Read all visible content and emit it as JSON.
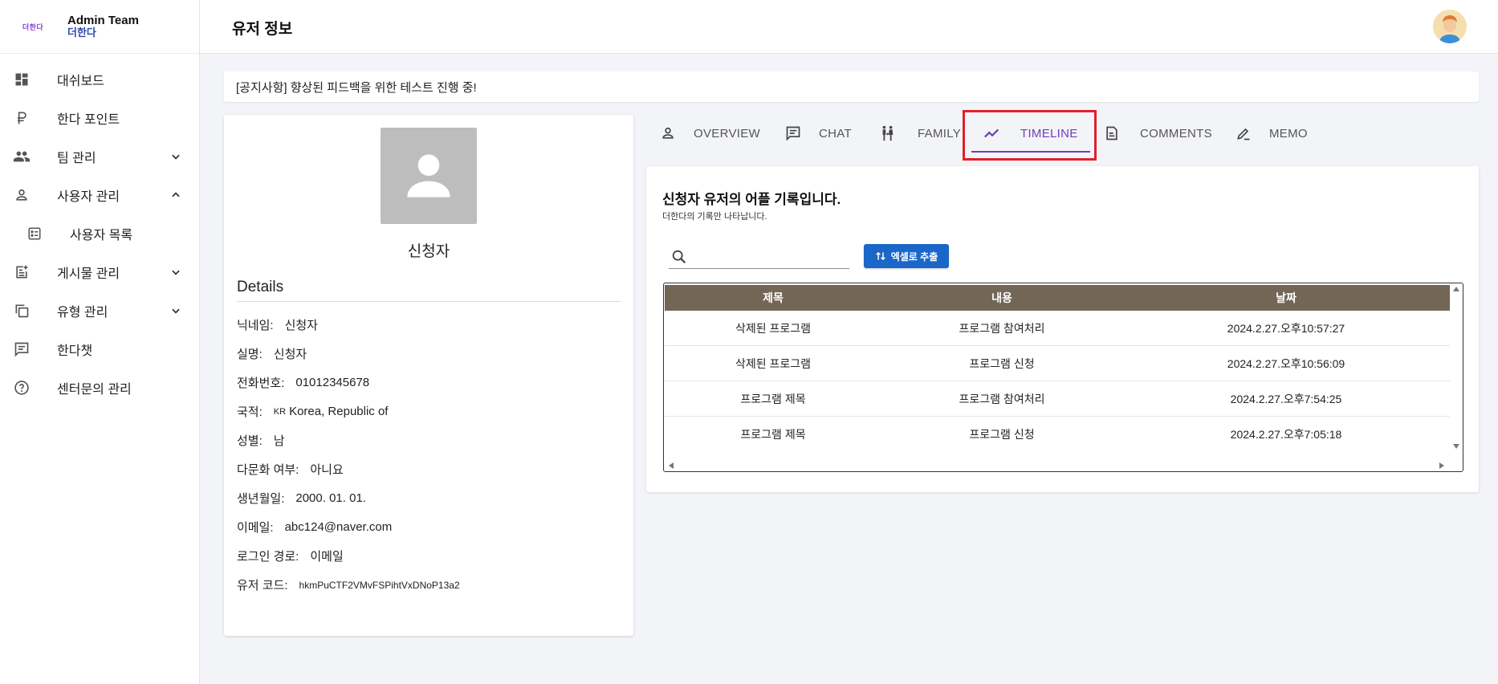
{
  "brand": {
    "logo_text": "더한다",
    "title": "Admin Team",
    "subtitle": "더한다"
  },
  "sidebar": {
    "items": [
      {
        "label": "대쉬보드",
        "icon": "dashboard-icon"
      },
      {
        "label": "한다 포인트",
        "icon": "ruble-icon"
      },
      {
        "label": "팀 관리",
        "icon": "group-icon",
        "expandable": true
      },
      {
        "label": "사용자 관리",
        "icon": "person-icon",
        "expanded": true
      },
      {
        "label": "사용자 목록",
        "icon": "list-icon",
        "sub": true
      },
      {
        "label": "게시물 관리",
        "icon": "post-add-icon",
        "expandable": true
      },
      {
        "label": "유형 관리",
        "icon": "copy-icon",
        "expandable": true
      },
      {
        "label": "한다챗",
        "icon": "chat-icon"
      },
      {
        "label": "센터문의 관리",
        "icon": "help-icon"
      }
    ]
  },
  "header": {
    "title": "유저 정보"
  },
  "notice": {
    "text": "[공지사항] 향상된 피드백을 위한 테스트 진행 중!"
  },
  "profile": {
    "name": "신청자",
    "details_title": "Details",
    "fields": [
      {
        "label": "닉네임:",
        "value": "신청자"
      },
      {
        "label": "실명:",
        "value": "신청자"
      },
      {
        "label": "전화번호:",
        "value": "01012345678"
      },
      {
        "label": "국적:",
        "flag": "KR",
        "value": "Korea, Republic of"
      },
      {
        "label": "성별:",
        "value": "남"
      },
      {
        "label": "다문화 여부:",
        "value": "아니요"
      },
      {
        "label": "생년월일:",
        "value": "2000. 01. 01."
      },
      {
        "label": "이메일:",
        "value": "abc124@naver.com"
      },
      {
        "label": "로그인 경로:",
        "value": "이메일"
      },
      {
        "label": "유저 코드:",
        "value": "hkmPuCTF2VMvFSPihtVxDNoP13a2"
      }
    ]
  },
  "tabs": [
    {
      "label": "OVERVIEW",
      "icon": "person-icon"
    },
    {
      "label": "CHAT",
      "icon": "chat-icon"
    },
    {
      "label": "FAMILY",
      "icon": "family-icon"
    },
    {
      "label": "TIMELINE",
      "icon": "timeline-icon",
      "active": true
    },
    {
      "label": "COMMENTS",
      "icon": "document-icon"
    },
    {
      "label": "MEMO",
      "icon": "edit-icon"
    }
  ],
  "timeline": {
    "title": "신청자 유저의 어플 기록입니다.",
    "subtitle": "더한다의 기록만 나타납니다.",
    "search_placeholder": "",
    "export_label": "엑셀로 추출",
    "columns": [
      "제목",
      "내용",
      "날짜"
    ],
    "rows": [
      [
        "삭제된 프로그램",
        "프로그램 참여처리",
        "2024.2.27.오후10:57:27"
      ],
      [
        "삭제된 프로그램",
        "프로그램 신청",
        "2024.2.27.오후10:56:09"
      ],
      [
        "프로그램 제목",
        "프로그램 참여처리",
        "2024.2.27.오후7:54:25"
      ],
      [
        "프로그램 제목",
        "프로그램 신청",
        "2024.2.27.오후7:05:18"
      ]
    ]
  },
  "colors": {
    "accent": "#6c3fb5",
    "highlight": "#e0202a",
    "table_header": "#736657",
    "button": "#1a66c9"
  }
}
